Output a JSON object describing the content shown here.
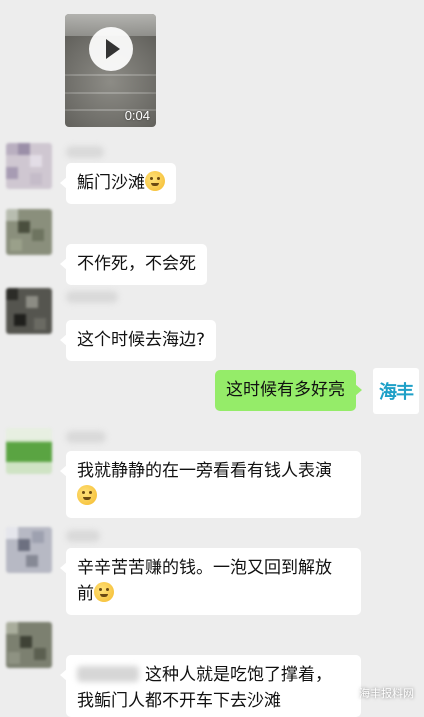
{
  "video": {
    "duration": "0:04",
    "play_icon": "play-icon"
  },
  "messages": [
    {
      "id": "m1",
      "side": "left",
      "text": "鮜门沙滩",
      "emoji": "laughing-tears-emoji"
    },
    {
      "id": "m2",
      "side": "left",
      "text": "不作死，不会死"
    },
    {
      "id": "m3",
      "side": "left",
      "text": "这个时候去海边?"
    },
    {
      "id": "m4",
      "side": "right",
      "text": "这时候有多好亮"
    },
    {
      "id": "m5",
      "side": "left",
      "line1": "我就静静的在一旁看看有钱人表演",
      "emoji": "smirk-emoji"
    },
    {
      "id": "m6",
      "side": "left",
      "line1": "辛辛苦苦赚的钱。一泡又回到解放",
      "line2": "前",
      "emoji": "thinking-emoji"
    },
    {
      "id": "m7",
      "side": "left",
      "line1": "这种人就是吃饱了撑着，",
      "line2": "我鲘门人都不开车下去沙滩"
    }
  ],
  "brand_avatar": {
    "text": "海丰"
  },
  "watermark": {
    "text": "海丰报料网",
    "icon": "wechat-icon"
  },
  "colors": {
    "background": "#ededed",
    "bubble_left": "#ffffff",
    "bubble_right": "#95ec69",
    "brand": "#1ea0c7"
  }
}
